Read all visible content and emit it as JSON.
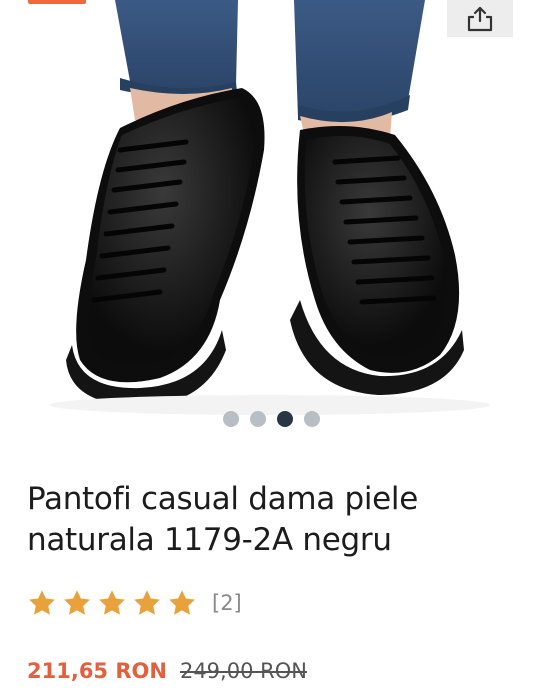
{
  "gallery": {
    "image_alt": "Pantofi casual dama piele naturala negri",
    "dots_total": 4,
    "active_dot_index": 2,
    "share_icon": "share-icon",
    "badge_color": "#ee6a3c"
  },
  "product": {
    "title": "Pantofi casual dama piele naturala 1179-2A negru",
    "rating_stars": 5,
    "review_count": "[2]",
    "price_current": "211,65 RON",
    "price_old": "249,00 RON"
  },
  "colors": {
    "accent": "#e25f3f",
    "star": "#e9a23b"
  }
}
